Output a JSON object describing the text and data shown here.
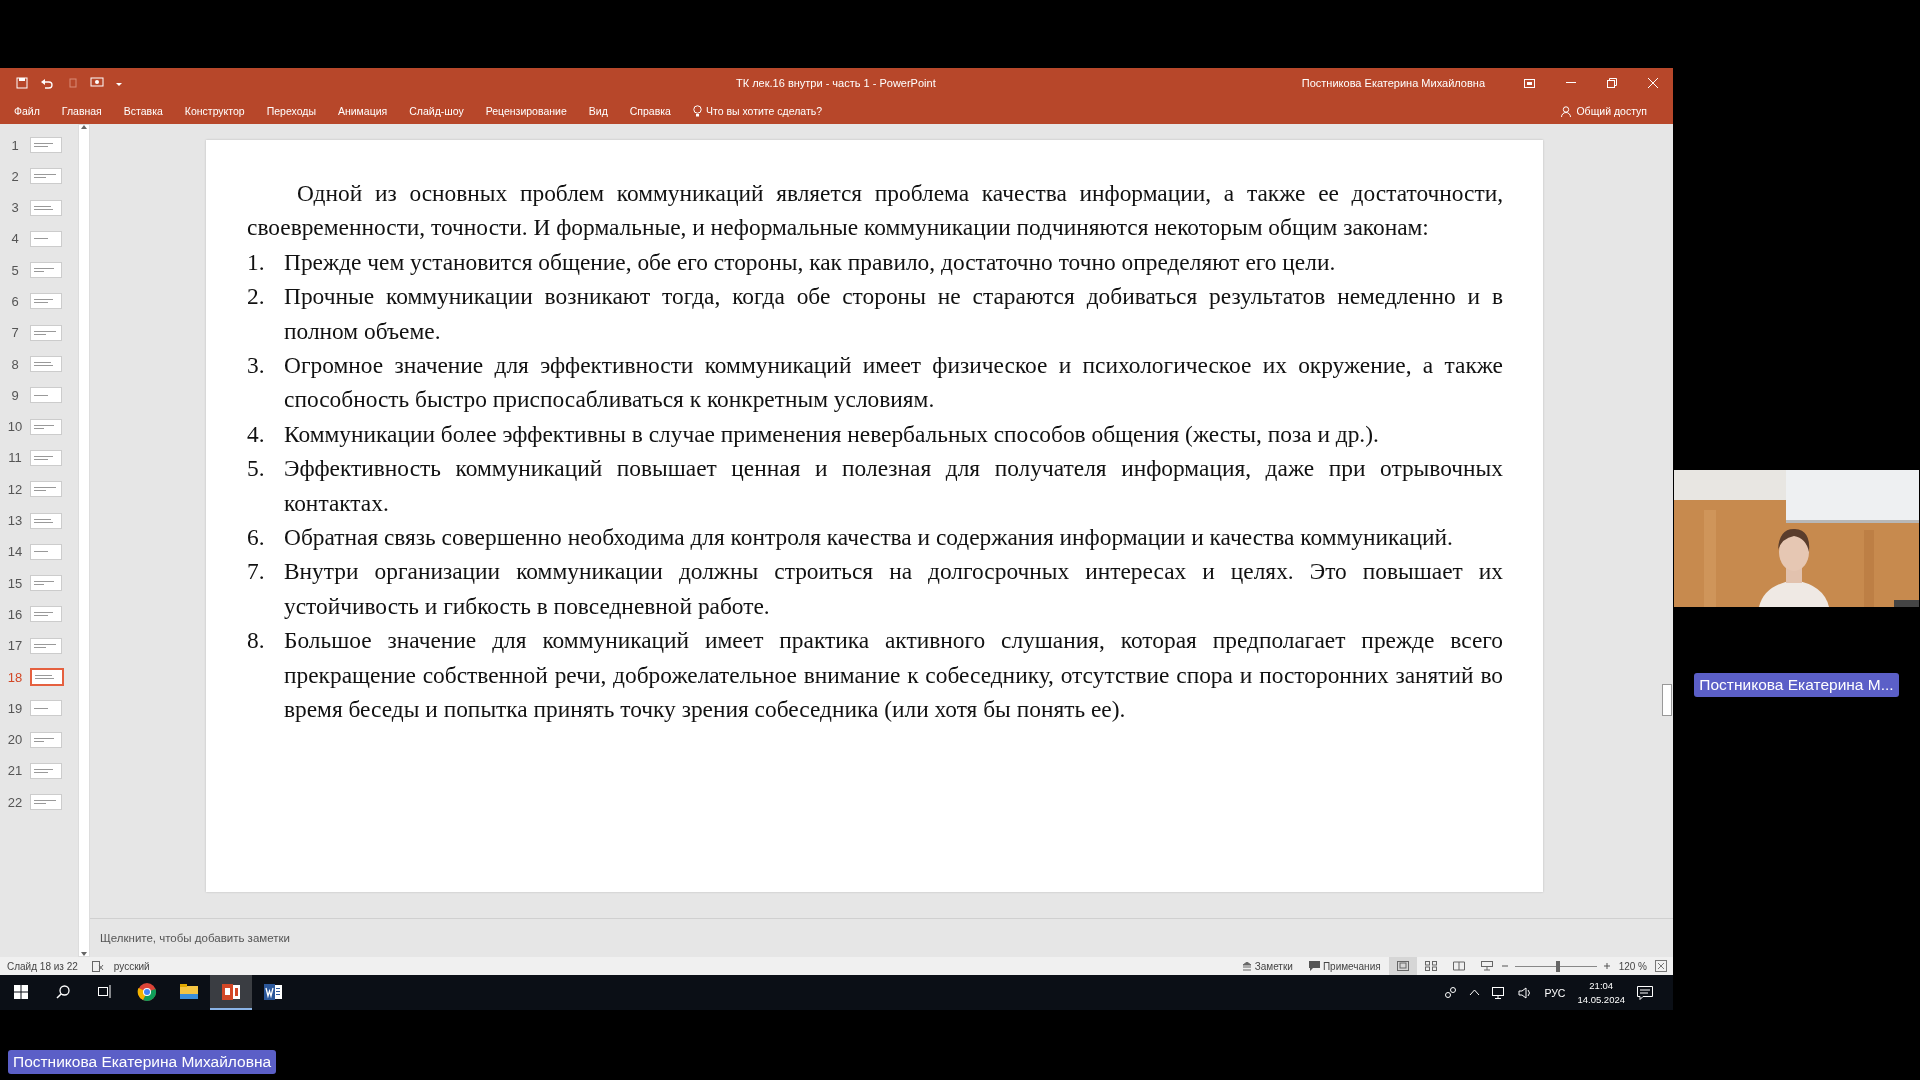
{
  "window": {
    "title": "ТК лек.16 внутри - часть 1  -  PowerPoint",
    "user": "Постникова Екатерина Михайловна"
  },
  "ribbon": {
    "tabs": [
      {
        "label": "Файл",
        "selected": false
      },
      {
        "label": "Главная",
        "selected": false
      },
      {
        "label": "Вставка",
        "selected": false
      },
      {
        "label": "Конструктор",
        "selected": false
      },
      {
        "label": "Переходы",
        "selected": false
      },
      {
        "label": "Анимация",
        "selected": false
      },
      {
        "label": "Слайд-шоу",
        "selected": false
      },
      {
        "label": "Рецензирование",
        "selected": false
      },
      {
        "label": "Вид",
        "selected": false
      },
      {
        "label": "Справка",
        "selected": false
      }
    ],
    "tell_me": "Что вы хотите сделать?",
    "share": "Общий доступ"
  },
  "thumbnails": [
    {
      "number": "1",
      "selected": false
    },
    {
      "number": "2",
      "selected": false
    },
    {
      "number": "3",
      "selected": false
    },
    {
      "number": "4",
      "selected": false
    },
    {
      "number": "5",
      "selected": false
    },
    {
      "number": "6",
      "selected": false
    },
    {
      "number": "7",
      "selected": false
    },
    {
      "number": "8",
      "selected": false
    },
    {
      "number": "9",
      "selected": false
    },
    {
      "number": "10",
      "selected": false
    },
    {
      "number": "11",
      "selected": false
    },
    {
      "number": "12",
      "selected": false
    },
    {
      "number": "13",
      "selected": false
    },
    {
      "number": "14",
      "selected": false
    },
    {
      "number": "15",
      "selected": false
    },
    {
      "number": "16",
      "selected": false
    },
    {
      "number": "17",
      "selected": false
    },
    {
      "number": "18",
      "selected": true
    },
    {
      "number": "19",
      "selected": false
    },
    {
      "number": "20",
      "selected": false
    },
    {
      "number": "21",
      "selected": false
    },
    {
      "number": "22",
      "selected": false
    }
  ],
  "slide": {
    "intro": "Одной из основных проблем коммуникаций является проблема качества информации, а также ее достаточности, своевременности, точности. И формальные, и неформальные коммуникации подчиняются некоторым общим законам:",
    "items": [
      {
        "number": "1.",
        "text": "Прежде чем установится общение, обе его стороны, как правило, достаточно точно определяют его цели."
      },
      {
        "number": "2.",
        "text": "Прочные коммуникации возникают тогда, когда обе стороны не стараются добиваться результатов немедленно и в полном объеме."
      },
      {
        "number": "3.",
        "text": "Огромное значение для эффективности коммуникаций имеет физическое и психологическое их окружение, а также способность быстро приспосабливаться к конкретным условиям."
      },
      {
        "number": "4.",
        "text": "Коммуникации более эффективны в случае применения невербальных способов общения (жесты, поза и др.)."
      },
      {
        "number": "5.",
        "text": "Эффективность коммуникаций повышает ценная и полезная для получателя информация, даже при отрывочных контактах."
      },
      {
        "number": "6.",
        "text": "Обратная связь совершенно необходима для контроля качества и содержания информации и качества коммуникаций."
      },
      {
        "number": "7.",
        "text": "Внутри организации коммуникации должны строиться на долгосрочных интересах и целях. Это повышает их устойчивость и гибкость в повседневной работе."
      },
      {
        "number": "8.",
        "text": "Большое значение для коммуникаций имеет практика активного слушания, которая предполагает прежде всего прекращение собственной речи, доброжелательное внимание к собеседнику, отсутствие спора и посторонних занятий во время беседы и попытка принять точку зрения собеседника (или хотя бы понять ее)."
      }
    ]
  },
  "notes_placeholder": "Щелкните, чтобы добавить заметки",
  "status_bar": {
    "slide_counter": "Слайд 18 из 22",
    "language": "русский",
    "notes": "Заметки",
    "comments": "Примечания",
    "zoom": {
      "level": 0.53,
      "reading": "120 %"
    }
  },
  "taskbar": {
    "apps": [
      {
        "kind": "chrome",
        "selected": false
      },
      {
        "kind": "explorer",
        "selected": false
      },
      {
        "kind": "powerpoint",
        "selected": true
      },
      {
        "kind": "word",
        "selected": false
      }
    ],
    "input_language": "РУС",
    "time": "21:04",
    "date": "14.05.2024"
  },
  "video": {
    "name": "Постникова Екатерина М..."
  },
  "presenter_label": "Постникова Екатерина Михайловна"
}
